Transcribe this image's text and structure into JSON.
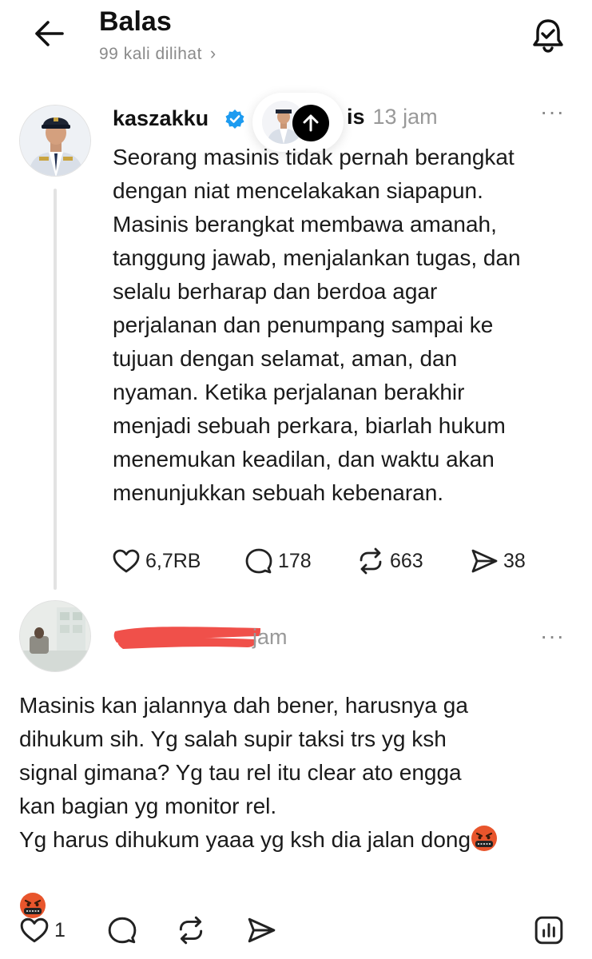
{
  "header": {
    "title": "Balas",
    "views": "99 kali dilihat",
    "icons": [
      "back-arrow-icon",
      "bell-icon",
      "chevron-right-icon"
    ]
  },
  "post": {
    "username": "kaszakku",
    "time_prefix": "is",
    "time": "13 jam",
    "more": "···",
    "text": "Seorang masinis tidak pernah berangkat\ndengan niat mencelakakan siapapun.\nMasinis berangkat membawa amanah,\ntanggung jawab, menjalankan tugas, dan\nselalu berharap dan berdoa agar\nperjalanan dan penumpang sampai ke\ntujuan dengan selamat, aman, dan\nnyaman. Ketika perjalanan berakhir\nmenjadi sebuah perkara, biarlah hukum\nmenemukan keadilan, dan waktu akan\nmenunjukkan sebuah kebenaran.",
    "likes": "6,7RB",
    "replies": "178",
    "reposts": "663",
    "shares": "38",
    "verified_color": "#1d9bf0"
  },
  "reply": {
    "time_suffix": "jam",
    "more": "···",
    "text_line1": "Masinis kan jalannya dah bener, harusnya ga\ndihukum sih. Yg salah supir taksi trs yg ksh\nsignal gimana? Yg tau rel itu clear ato engga\nkan bagian yg monitor rel.\nYg harus dihukum yaaa yg ksh dia jalan dong",
    "likes": "1",
    "redaction_color": "#f0504a"
  }
}
